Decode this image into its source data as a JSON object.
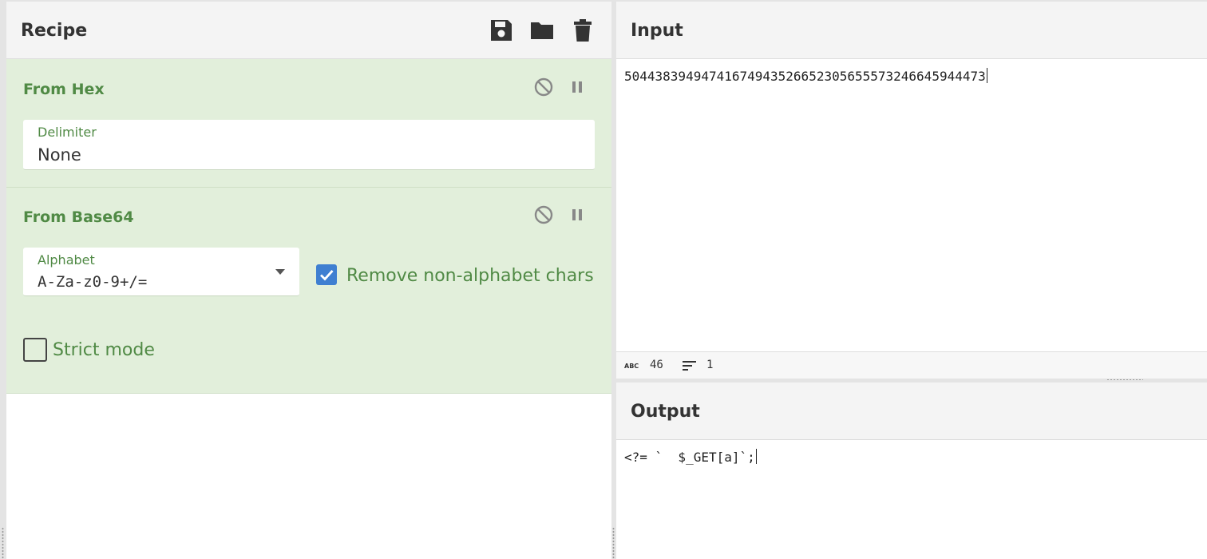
{
  "recipe": {
    "title": "Recipe",
    "header_icons": [
      "save-icon",
      "folder-icon",
      "trash-icon"
    ],
    "operations": [
      {
        "title": "From Hex",
        "delimiter_label": "Delimiter",
        "delimiter_value": "None"
      },
      {
        "title": "From Base64",
        "alphabet_label": "Alphabet",
        "alphabet_value": "A-Za-z0-9+/=",
        "remove_non_alphabet_label": "Remove non-alphabet chars",
        "remove_non_alphabet_checked": true,
        "strict_mode_label": "Strict mode",
        "strict_mode_checked": false
      }
    ]
  },
  "input": {
    "title": "Input",
    "text": "50443839494741674943526652305655573246645944473",
    "status": {
      "length": "46",
      "lines": "1"
    }
  },
  "output": {
    "title": "Output",
    "text": "<?= `  $_GET[a]`;"
  },
  "colors": {
    "operation_bg": "#e2efdb",
    "operation_title": "#508a45",
    "checkbox_on": "#3f7fd1"
  }
}
